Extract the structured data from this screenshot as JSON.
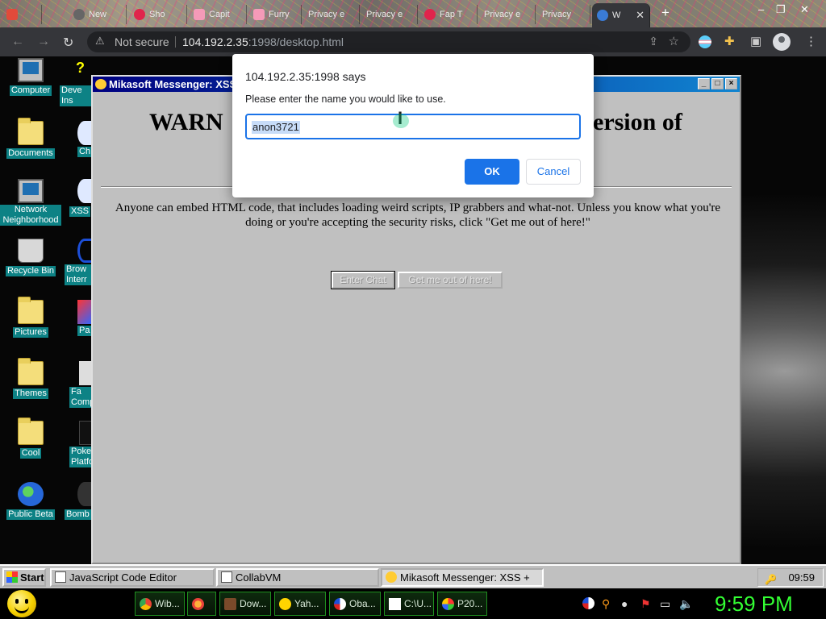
{
  "browser": {
    "tabs": [
      {
        "label": "",
        "color": "#e24a3a"
      },
      {
        "label": "New",
        "color": "#666666"
      },
      {
        "label": "Sho",
        "color": "#e0244c"
      },
      {
        "label": "Capit",
        "color": "#f59ab8"
      },
      {
        "label": "Furry",
        "color": "#f59ab8"
      },
      {
        "label": "Privacy e",
        "color": "#777777"
      },
      {
        "label": "Privacy e",
        "color": "#777777"
      },
      {
        "label": "Fap T",
        "color": "#e0244c"
      },
      {
        "label": "Privacy e",
        "color": "#777777"
      },
      {
        "label": "Privacy",
        "color": "#777777"
      },
      {
        "label": "W",
        "color": "#3a7bd5"
      }
    ],
    "new_tab": "+",
    "window_controls": {
      "minimize": "–",
      "restore": "❐",
      "close": "✕"
    },
    "security_label": "Not secure",
    "url_host": "104.192.2.35",
    "url_rest": ":1998/desktop.html"
  },
  "desktop": {
    "icons_col1": [
      {
        "label": "Computer",
        "icon": "computer-icon"
      },
      {
        "label": "Documents",
        "icon": "documents-icon"
      },
      {
        "label": "Network Neighborhood",
        "icon": "network-icon"
      },
      {
        "label": "Recycle Bin",
        "icon": "recycle-bin-icon"
      },
      {
        "label": "Pictures",
        "icon": "folder-icon"
      },
      {
        "label": "Themes",
        "icon": "folder-icon"
      },
      {
        "label": "Cool",
        "icon": "folder-icon"
      },
      {
        "label": "Public Beta",
        "icon": "globe-icon"
      }
    ],
    "icons_col2": [
      {
        "label": "Deve Ins",
        "icon": "help-icon"
      },
      {
        "label": "Ch",
        "icon": "chat-icon"
      },
      {
        "label": "XSS",
        "icon": "chat-icon"
      },
      {
        "label": "Brow Interr",
        "icon": "browser-icon"
      },
      {
        "label": "Pa",
        "icon": "paint-icon"
      },
      {
        "label": "Fa Comp",
        "icon": "app-icon"
      },
      {
        "label": "Poke Platfo",
        "icon": "app-icon"
      },
      {
        "label": "Bomb",
        "icon": "app-icon"
      }
    ]
  },
  "messenger": {
    "title": "Mikasoft Messenger: XSS",
    "heading_left": "WARN",
    "heading_right": "ersion of",
    "body": "Anyone can embed HTML code, that includes loading weird scripts, IP grabbers and what-not. Unless you know what you're doing or you're accepting the security risks, click \"Get me out of here!\"",
    "enter_chat": "Enter Chat",
    "get_out": "Get me out of here!"
  },
  "prompt": {
    "origin": "104.192.2.35:1998 says",
    "message": "Please enter the name you would like to use.",
    "value": "anon3721",
    "ok": "OK",
    "cancel": "Cancel"
  },
  "taskbar98": {
    "start": "Start",
    "tasks": [
      "JavaScript Code Editor",
      "CollabVM",
      "Mikasoft Messenger: XSS +"
    ],
    "time": "09:59"
  },
  "host_taskbar": {
    "tasks": [
      "Wib...",
      "",
      "Dow...",
      "Yah...",
      "Oba...",
      "C:\\U...",
      "P20..."
    ],
    "clock": "9:59 PM"
  }
}
